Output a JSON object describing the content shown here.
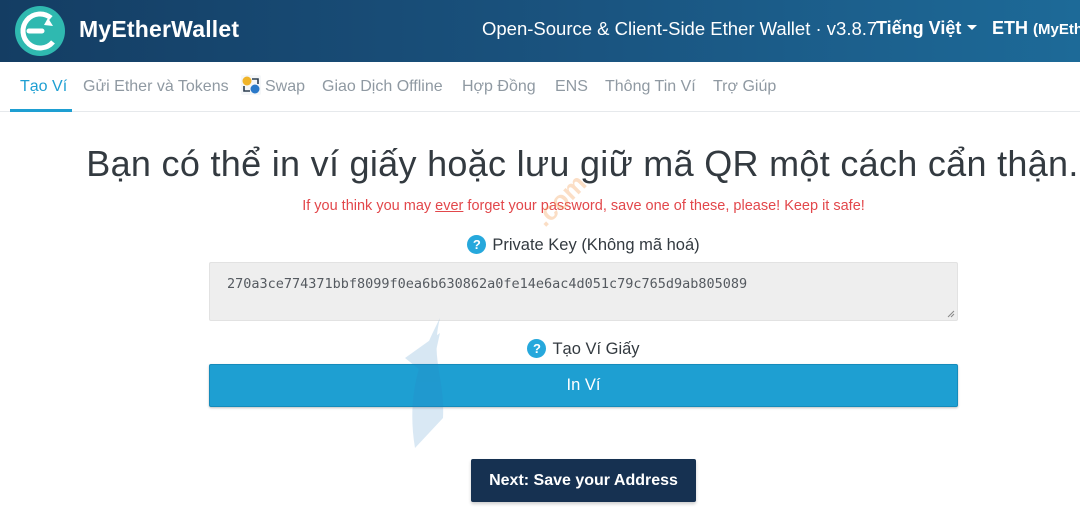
{
  "header": {
    "brand": "MyEtherWallet",
    "tagline": "Open-Source & Client-Side Ether Wallet · v3.8.7",
    "language": "Tiếng Việt",
    "network_main": "ETH",
    "network_sub": "(MyEth",
    "logo_icon": "mew-logo-icon",
    "caret_icon": "caret-down-icon"
  },
  "nav": {
    "items": [
      {
        "label": "Tạo Ví"
      },
      {
        "label": "Gửi Ether và Tokens"
      },
      {
        "label": "Swap"
      },
      {
        "label": "Giao Dịch Offline"
      },
      {
        "label": "Hợp Đồng"
      },
      {
        "label": "ENS"
      },
      {
        "label": "Thông Tin Ví"
      },
      {
        "label": "Trợ Giúp"
      }
    ],
    "active_index": 0,
    "active_color": "#1e9fd2"
  },
  "main": {
    "headline": "Bạn có thể in ví giấy hoặc lưu giữ mã QR một cách cẩn thận.",
    "warning_before": "If you think you may ",
    "warning_emphasis": "ever",
    "warning_after": " forget your password, save one of these, please! Keep it safe!",
    "private_key_label": "Private Key (Không mã hoá)",
    "private_key_value": "270a3ce774371bbf8099f0ea6b630862a0fe14e6ac4d051c79c765d9ab805089",
    "paper_wallet_label": "Tạo Ví Giấy",
    "print_button": "In Ví",
    "next_button": "Next: Save your Address",
    "help_icon": "?",
    "watermark": ".com"
  },
  "colors": {
    "header_start": "#143d63",
    "header_end": "#1d6a98",
    "accent": "#1e9fd2",
    "warning": "#e2474b",
    "dark_button": "#163151"
  }
}
